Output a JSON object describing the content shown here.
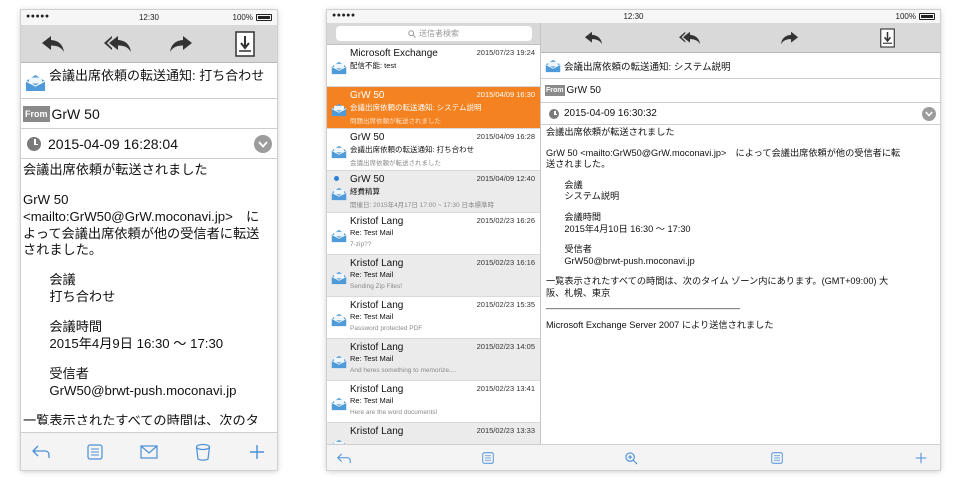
{
  "phone": {
    "status": {
      "signal": "●●●●● ",
      "time": "12:30",
      "battery": "100%"
    },
    "subject": "会議出席依頼の転送通知: 打ち合わせ",
    "from_tag": "From",
    "from_name": "GrW 50",
    "date": "2015-04-09 16:28:04",
    "body_lines": [
      "会議出席依頼が転送されました",
      "",
      "GrW 50",
      "<mailto:GrW50@GrW.moconavi.jp>　に",
      "よって会議出席依頼が他の受信者に転送",
      "されました。",
      "",
      "　　会議",
      "　　打ち合わせ",
      "",
      "　　会議時間",
      "　　2015年4月9日 16:30 〜 17:30",
      "",
      "　　受信者",
      "　　GrW50@brwt-push.moconavi.jp",
      "",
      "一覧表示されたすべての時間は、次のタ"
    ]
  },
  "tablet": {
    "status": {
      "signal": "●●●●● ",
      "time": "12:30",
      "battery": "100%"
    },
    "search_placeholder": "送信者検索",
    "messages": [
      {
        "sender": "Microsoft Exchange",
        "date": "2015/07/23 19:24",
        "subject": "配信不能: test",
        "preview": "",
        "unread": false
      },
      {
        "sender": "GrW 50",
        "date": "2015/04/09 16:30",
        "subject": "会議出席依頼の転送通知: システム説明",
        "preview": "問題出席依頼が転送されました",
        "unread": false
      },
      {
        "sender": "GrW 50",
        "date": "2015/04/09 16:28",
        "subject": "会議出席依頼の転送通知: 打ち合わせ",
        "preview": "会議出席依頼が転送されました",
        "unread": false
      },
      {
        "sender": "GrW 50",
        "date": "2015/04/09 12:40",
        "subject": "経費精算",
        "preview": "開催日: 2015年4月17日 17:00 ~ 17:30 日本標準時",
        "unread": true
      },
      {
        "sender": "Kristof Lang",
        "date": "2015/02/23 16:26",
        "subject": "Re: Test Mail",
        "preview": "7-zip??",
        "unread": false
      },
      {
        "sender": "Kristof Lang",
        "date": "2015/02/23 16:16",
        "subject": "Re: Test Mail",
        "preview": "Sending Zip Files!",
        "unread": false
      },
      {
        "sender": "Kristof Lang",
        "date": "2015/02/23 15:35",
        "subject": "Re: Test Mail",
        "preview": "Password protected PDF",
        "unread": false
      },
      {
        "sender": "Kristof Lang",
        "date": "2015/02/23 14:05",
        "subject": "Re: Test Mail",
        "preview": "And heres something to memorize....",
        "unread": false
      },
      {
        "sender": "Kristof Lang",
        "date": "2015/02/23 13:41",
        "subject": "Re: Test Mail",
        "preview": "Here are the word documents!",
        "unread": false
      },
      {
        "sender": "Kristof Lang",
        "date": "2015/02/23 13:33",
        "subject": "",
        "preview": "",
        "unread": false
      }
    ],
    "subject": "会議出席依頼の転送通知: システム説明",
    "from_tag": "From",
    "from_name": "GrW 50",
    "date": "2015-04-09 16:30:32",
    "body_lines": [
      "会議出席依頼が転送されました",
      "",
      "GrW 50 <mailto:GrW50@GrW.moconavi.jp>　によって会議出席依頼が他の受信者に転",
      "送されました。",
      "",
      "　　会議",
      "　　システム説明",
      "",
      "　　会議時間",
      "　　2015年4月10日 16:30 〜 17:30",
      "",
      "　　受信者",
      "　　GrW50@brwt-push.moconavi.jp",
      "",
      "一覧表示されたすべての時間は、次のタイム ゾーン内にあります。(GMT+09:00) 大",
      "阪、札幌、東京",
      "______________________________________",
      "",
      "Microsoft Exchange Server 2007 により送信されました"
    ]
  },
  "icons": {
    "toolbar": [
      "reply-icon",
      "reply-all-icon",
      "forward-icon",
      "save-download-icon"
    ],
    "phone_bottom": [
      "back-icon",
      "list-icon",
      "mail-icon",
      "trash-icon",
      "add-icon"
    ],
    "tablet_bottom": [
      "back-icon",
      "list-icon",
      "zoom-icon",
      "list-icon",
      "add-icon"
    ]
  }
}
